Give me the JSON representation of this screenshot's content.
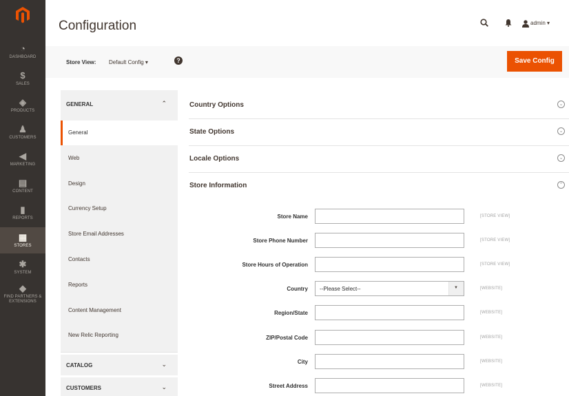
{
  "nav": {
    "logo": "magento-logo-icon",
    "items": [
      {
        "icon": "dashboard-icon",
        "glyph": "◔",
        "label": "DASHBOARD"
      },
      {
        "icon": "sales-icon",
        "glyph": "$",
        "label": "SALES"
      },
      {
        "icon": "products-icon",
        "glyph": "◈",
        "label": "PRODUCTS"
      },
      {
        "icon": "customers-icon",
        "glyph": "♟",
        "label": "CUSTOMERS"
      },
      {
        "icon": "marketing-icon",
        "glyph": "◀",
        "label": "MARKETING"
      },
      {
        "icon": "content-icon",
        "glyph": "▤",
        "label": "CONTENT"
      },
      {
        "icon": "reports-icon",
        "glyph": "▮",
        "label": "REPORTS"
      },
      {
        "icon": "stores-icon",
        "glyph": "▦",
        "label": "STORES"
      },
      {
        "icon": "system-icon",
        "glyph": "✱",
        "label": "SYSTEM"
      },
      {
        "icon": "extensions-icon",
        "glyph": "◆",
        "label": "FIND PARTNERS & EXTENSIONS"
      }
    ]
  },
  "header": {
    "title": "Configuration",
    "user": "admin ▾"
  },
  "scope": {
    "label": "Store View:",
    "value": "Default Config ▾",
    "help": "?",
    "save_label": "Save Config"
  },
  "sidebar": {
    "general_tab": "GENERAL",
    "general_items": [
      "General",
      "Web",
      "Design",
      "Currency Setup",
      "Store Email Addresses",
      "Contacts",
      "Reports",
      "Content Management",
      "New Relic Reporting"
    ],
    "catalog_tab": "CATALOG",
    "customers_tab": "CUSTOMERS"
  },
  "sections": [
    {
      "label": "Country Options",
      "expanded": false
    },
    {
      "label": "State Options",
      "expanded": false
    },
    {
      "label": "Locale Options",
      "expanded": false
    },
    {
      "label": "Store Information",
      "expanded": true
    }
  ],
  "store_info": {
    "fields": [
      {
        "label": "Store Name",
        "type": "text",
        "value": "",
        "scope": "[STORE VIEW]"
      },
      {
        "label": "Store Phone Number",
        "type": "text",
        "value": "",
        "scope": "[STORE VIEW]"
      },
      {
        "label": "Store Hours of Operation",
        "type": "text",
        "value": "",
        "scope": "[STORE VIEW]"
      },
      {
        "label": "Country",
        "type": "select",
        "value": "--Please Select--",
        "scope": "[WEBSITE]"
      },
      {
        "label": "Region/State",
        "type": "text",
        "value": "",
        "scope": "[WEBSITE]"
      },
      {
        "label": "ZIP/Postal Code",
        "type": "text",
        "value": "",
        "scope": "[WEBSITE]"
      },
      {
        "label": "City",
        "type": "text",
        "value": "",
        "scope": "[WEBSITE]"
      },
      {
        "label": "Street Address",
        "type": "text",
        "value": "",
        "scope": "[WEBSITE]"
      }
    ]
  },
  "colors": {
    "accent": "#eb5202",
    "nav_bg": "#373330",
    "nav_active": "#514943"
  }
}
